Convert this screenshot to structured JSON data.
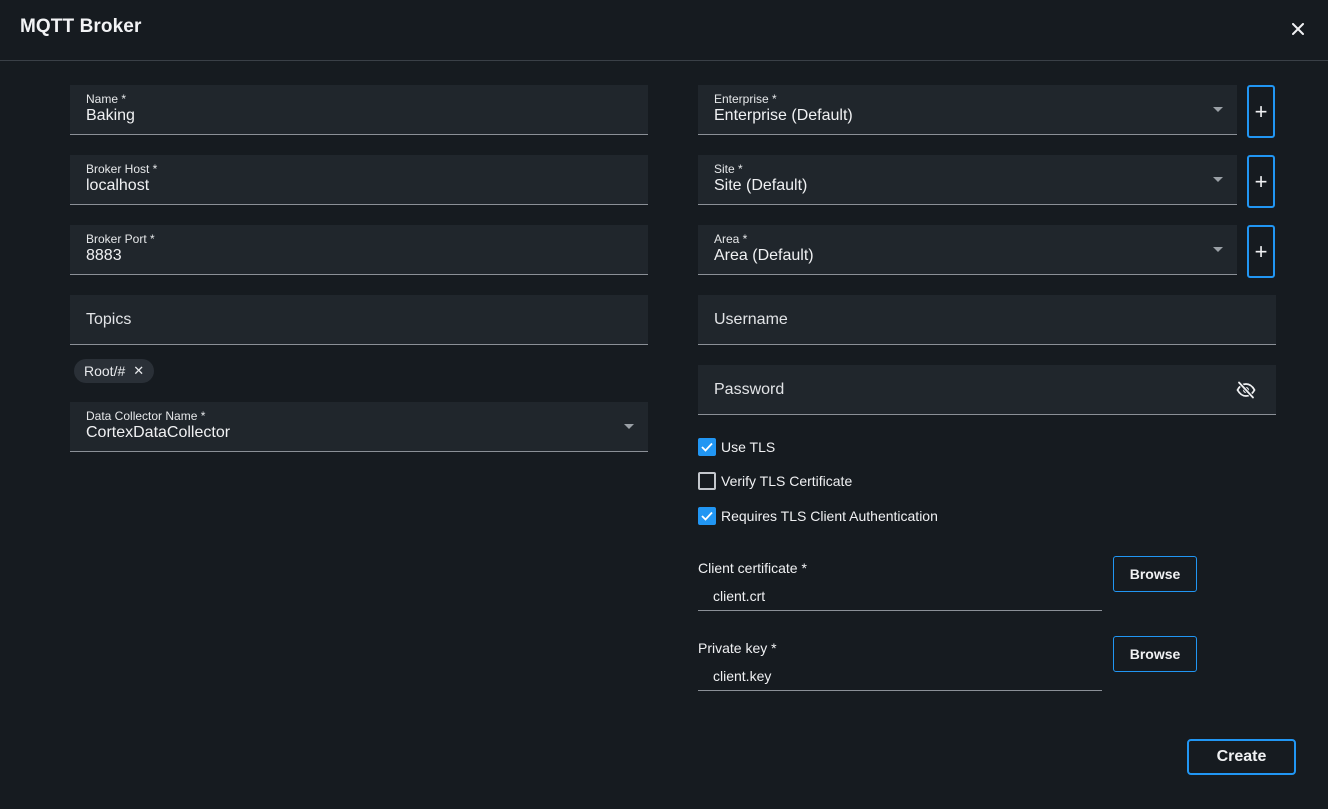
{
  "dialog": {
    "title": "MQTT Broker",
    "close_icon": "close-icon"
  },
  "left": {
    "name": {
      "label": "Name *",
      "value": "Baking"
    },
    "broker_host": {
      "label": "Broker Host *",
      "value": "localhost"
    },
    "broker_port": {
      "label": "Broker Port *",
      "value": "8883"
    },
    "topics": {
      "placeholder": "Topics",
      "chips": [
        {
          "label": "Root/#"
        }
      ]
    },
    "data_collector": {
      "label": "Data Collector Name *",
      "value": "CortexDataCollector"
    }
  },
  "right": {
    "enterprise": {
      "label": "Enterprise *",
      "value": "Enterprise (Default)"
    },
    "site": {
      "label": "Site *",
      "value": "Site (Default)"
    },
    "area": {
      "label": "Area *",
      "value": "Area (Default)"
    },
    "add_label": "+",
    "username": {
      "placeholder": "Username"
    },
    "password": {
      "placeholder": "Password",
      "icon": "eye-off-icon"
    },
    "checkboxes": [
      {
        "label": "Use TLS",
        "checked": true
      },
      {
        "label": "Verify TLS Certificate",
        "checked": false
      },
      {
        "label": "Requires TLS Client Authentication",
        "checked": true
      }
    ],
    "client_certificate": {
      "label": "Client certificate *",
      "value": "client.crt",
      "browse": "Browse"
    },
    "private_key": {
      "label": "Private key *",
      "value": "client.key",
      "browse": "Browse"
    }
  },
  "footer": {
    "create_label": "Create"
  },
  "colors": {
    "background": "#161b20",
    "field": "#20262c",
    "accent": "#2196f3"
  }
}
